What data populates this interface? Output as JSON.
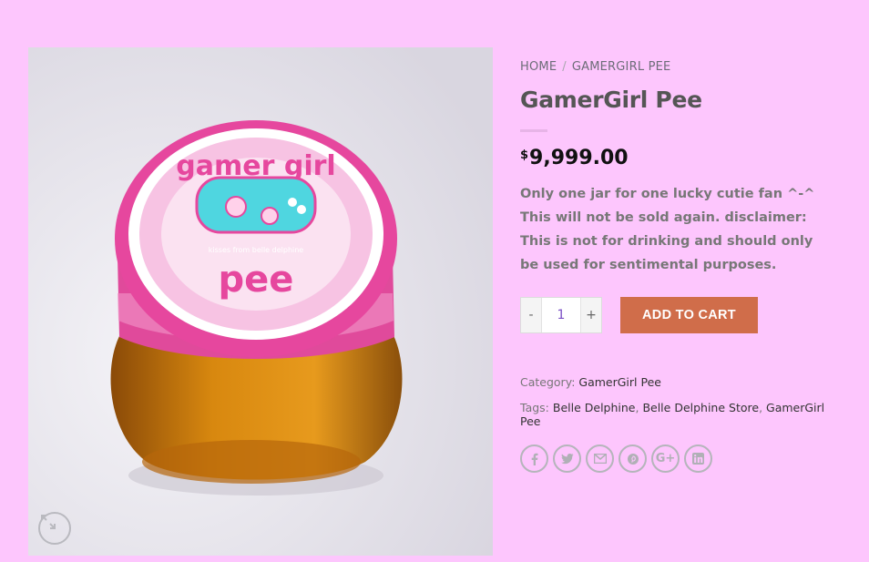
{
  "breadcrumb": {
    "home": "HOME",
    "sep": "/",
    "category": "GAMERGIRL PEE"
  },
  "product": {
    "title": "GamerGirl Pee",
    "currency": "$",
    "price": "9,999.00",
    "description": "Only one jar for one lucky cutie fan ^-^ This will not be sold again. disclaimer: This is not for drinking and should only be used for sentimental purposes."
  },
  "cart": {
    "minus": "-",
    "qty": "1",
    "plus": "+",
    "add_label": "ADD TO CART"
  },
  "meta": {
    "category_label": "Category:",
    "category_value": "GamerGirl Pee",
    "tags_label": "Tags:",
    "tags": [
      "Belle Delphine",
      "Belle Delphine Store",
      "GamerGirl Pee"
    ]
  },
  "image": {
    "lid_top": "gamer girl",
    "lid_bottom": "pee",
    "lid_small": "kisses from belle delphine"
  },
  "share_icons": [
    "facebook-icon",
    "twitter-icon",
    "email-icon",
    "pinterest-icon",
    "google-plus-icon",
    "linkedin-icon"
  ],
  "colors": {
    "background": "#fdc6fd",
    "button": "#d06d4a",
    "lid": "#e6479e",
    "honey": "#c9780c"
  }
}
